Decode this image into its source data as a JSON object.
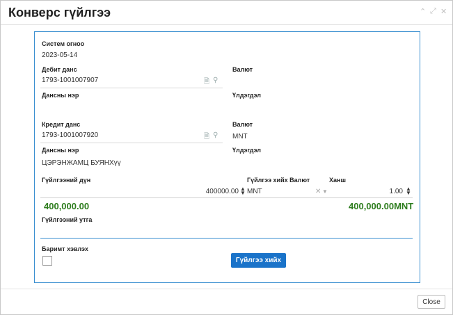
{
  "dialog": {
    "title": "Конверс гүйлгээ",
    "close_label": "Close",
    "submit_label": "Гүйлгээ хийх"
  },
  "window_controls": {
    "collapse_icon": "chevron-up-icon",
    "expand_icon": "expand-icon",
    "close_icon": "close-icon"
  },
  "form": {
    "system_date_label": "Систем огноо",
    "system_date_value": "2023-05-14",
    "debit_account_label": "Дебит данс",
    "debit_account_value": "1793-1001007907",
    "debit_currency_label": "Валют",
    "debit_currency_value": "",
    "debit_account_name_label": "Дансны нэр",
    "debit_account_name_value": "",
    "debit_balance_label": "Үлдэгдэл",
    "debit_balance_value": "",
    "credit_account_label": "Кредит данс",
    "credit_account_value": "1793-1001007920",
    "credit_currency_label": "Валют",
    "credit_currency_value": "MNT",
    "credit_account_name_label": "Дансны нэр",
    "credit_account_name_value": "ЦЭРЭНЖАМЦ БУЯНХүү",
    "credit_balance_label": "Үлдэгдэл",
    "credit_balance_value": "",
    "amount_label": "Гүйлгээний дүн",
    "amount_value": "400000.00",
    "tx_currency_label": "Гүйлгээ хийх Валют",
    "tx_currency_value": "MNT",
    "rate_label": "Ханш",
    "rate_value": "1.00",
    "amount_display": "400,000.00",
    "converted_display": "400,000.00MNT",
    "description_label": "Гүйлгээний утга",
    "description_value": "",
    "print_receipt_label": "Баримт хэвлэх"
  },
  "colors": {
    "accent": "#1a73c9",
    "frame_border": "#3b8fd0",
    "amount_green": "#2e7d1e"
  }
}
